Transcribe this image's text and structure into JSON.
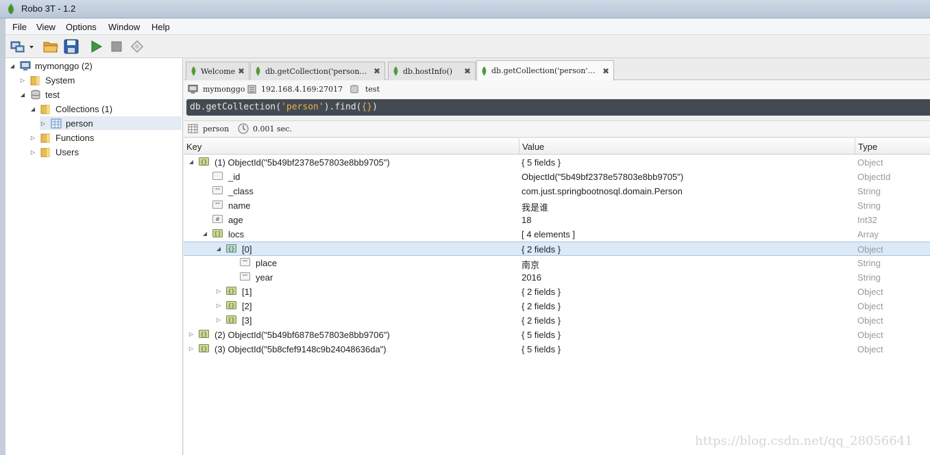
{
  "window": {
    "title": "Robo 3T - 1.2"
  },
  "menu": [
    "File",
    "View",
    "Options",
    "Window",
    "Help"
  ],
  "toolbar": {
    "icons": [
      "connect-icon",
      "dropdown-icon",
      "open-folder-icon",
      "save-icon",
      "run-icon",
      "stop-icon",
      "rotate-icon"
    ]
  },
  "tree": {
    "connection": "mymonggo (2)",
    "system": "System",
    "database": "test",
    "collections": "Collections (1)",
    "collection_person": "person",
    "functions": "Functions",
    "users": "Users"
  },
  "tabs": [
    {
      "label": "Welcome"
    },
    {
      "label": "db.getCollection('person…"
    },
    {
      "label": "db.hostInfo()"
    },
    {
      "label": "db.getCollection('person'…"
    }
  ],
  "info": {
    "server": "mymonggo",
    "address": "192.168.4.169:27017",
    "database": "test"
  },
  "query": {
    "prefix": "db.getCollection(",
    "arg": "'person'",
    "middle": ").find(",
    "braces": "{}",
    "suffix": ")"
  },
  "result": {
    "collection": "person",
    "time": "0.001 sec."
  },
  "grid": {
    "headers": {
      "key": "Key",
      "value": "Value",
      "type": "Type"
    },
    "rows": [
      {
        "key": "(1) ObjectId(\"5b49bf2378e57803e8bb9705\")",
        "value": "{ 5 fields }",
        "type": "Object"
      },
      {
        "key": "_id",
        "value": "ObjectId(\"5b49bf2378e57803e8bb9705\")",
        "type": "ObjectId"
      },
      {
        "key": "_class",
        "value": "com.just.springbootnosql.domain.Person",
        "type": "String"
      },
      {
        "key": "name",
        "value": "我是谁",
        "type": "String"
      },
      {
        "key": "age",
        "value": "18",
        "type": "Int32"
      },
      {
        "key": "locs",
        "value": "[ 4 elements ]",
        "type": "Array"
      },
      {
        "key": "[0]",
        "value": "{ 2 fields }",
        "type": "Object"
      },
      {
        "key": "place",
        "value": "南京",
        "type": "String"
      },
      {
        "key": "year",
        "value": "2016",
        "type": "String"
      },
      {
        "key": "[1]",
        "value": "{ 2 fields }",
        "type": "Object"
      },
      {
        "key": "[2]",
        "value": "{ 2 fields }",
        "type": "Object"
      },
      {
        "key": "[3]",
        "value": "{ 2 fields }",
        "type": "Object"
      },
      {
        "key": "(2) ObjectId(\"5b49bf6878e57803e8bb9706\")",
        "value": "{ 5 fields }",
        "type": "Object"
      },
      {
        "key": "(3) ObjectId(\"5b8cfef9148c9b24048636da\")",
        "value": "{ 5 fields }",
        "type": "Object"
      }
    ]
  },
  "watermark": "https://blog.csdn.net/qq_28056641"
}
